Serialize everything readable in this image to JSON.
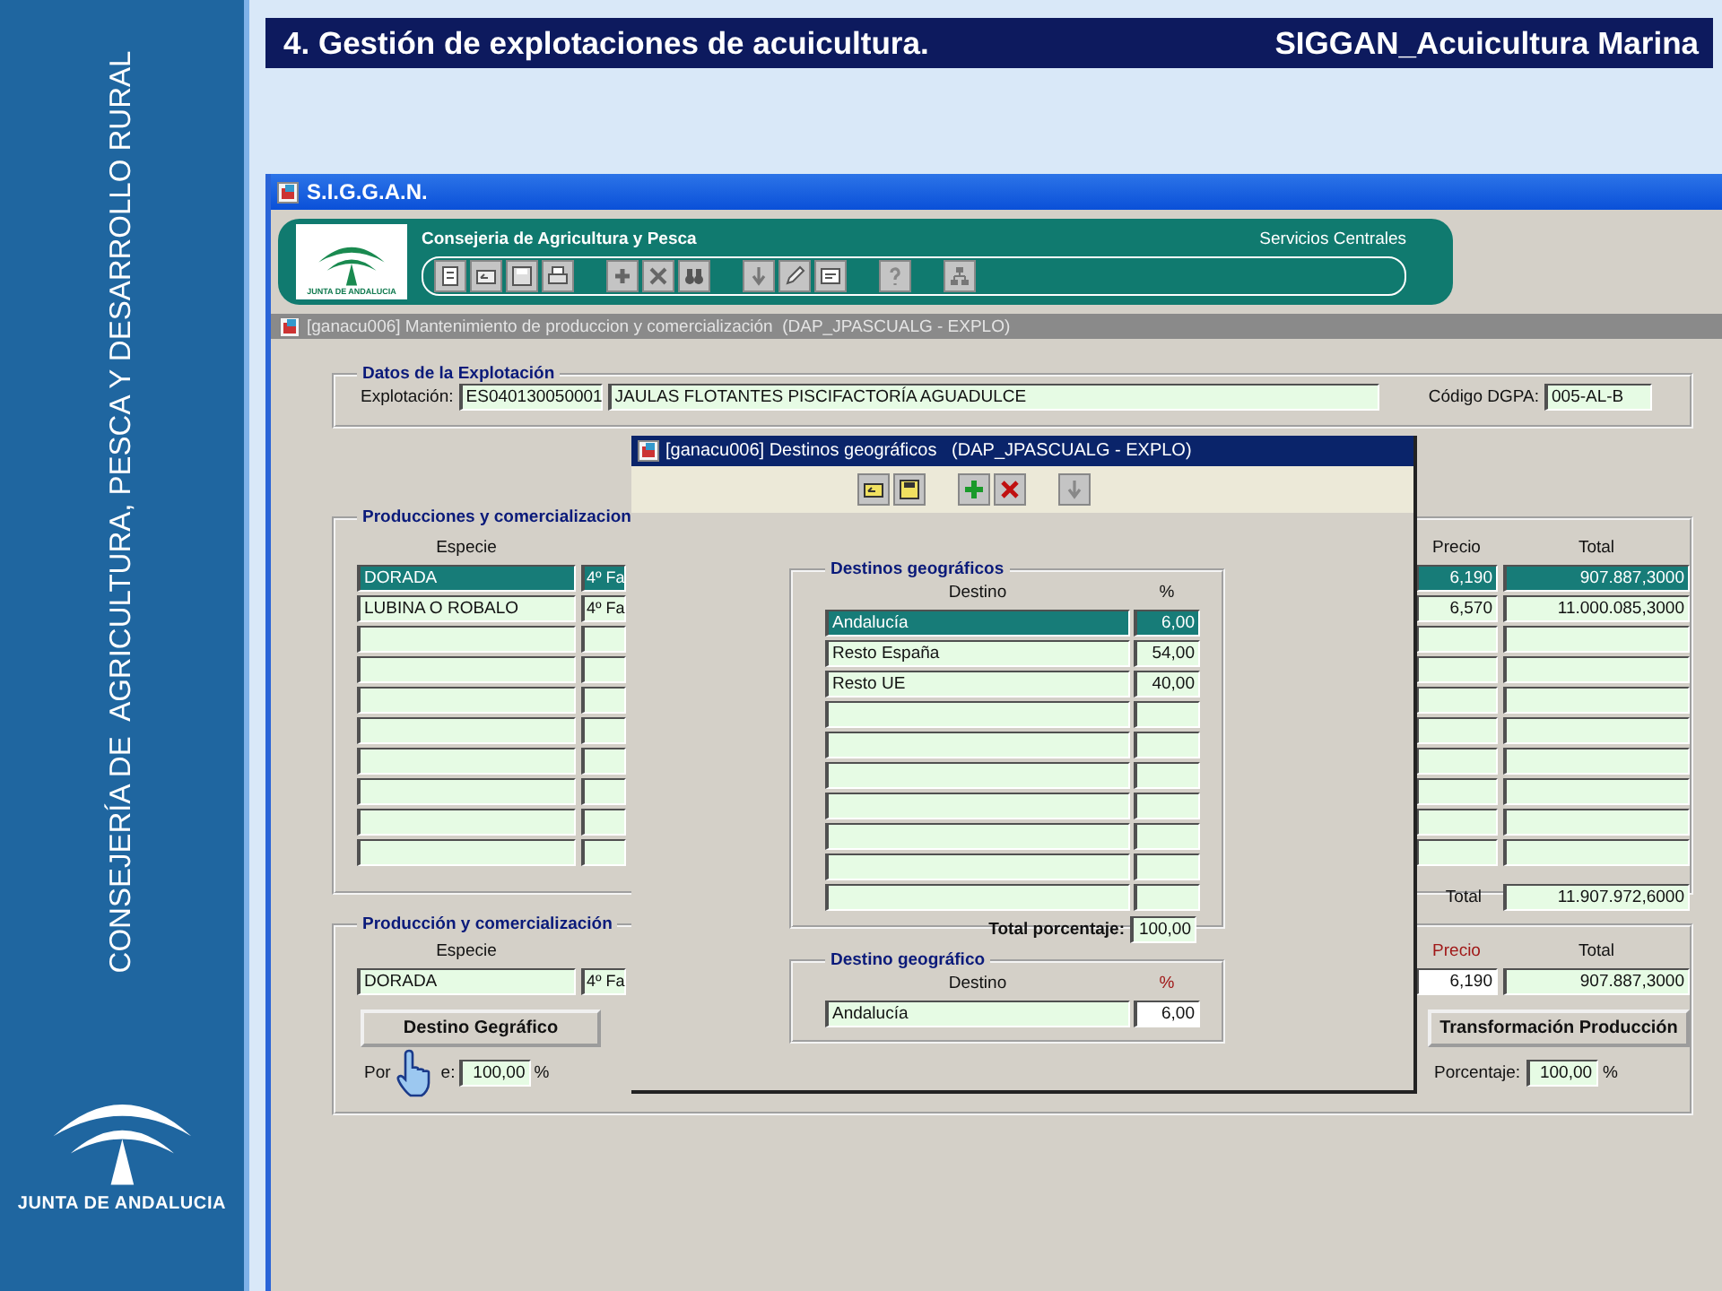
{
  "slide_header": {
    "title": "4. Gestión de explotaciones de acuicultura.",
    "subtitle": "SIGGAN_Acuicultura Marina"
  },
  "sidebar": {
    "text": "CONSEJERÍA DE  AGRICULTURA, PESCA Y DESARROLLO RURAL",
    "logo_text": "JUNTA DE ANDALUCIA"
  },
  "window": {
    "title": "S.I.G.G.A.N.",
    "org": "Consejeria de Agricultura y Pesca",
    "unit": "Servicios Centrales",
    "logo_text": "JUNTA DE ANDALUCIA"
  },
  "form": {
    "title": "[ganacu006] Mantenimiento de produccion y comercialización  (DAP_JPASCUALG - EXPLO)",
    "datos": {
      "legend": "Datos de la Explotación",
      "explotacion_label": "Explotación:",
      "explotacion_code": "ES040130050001",
      "explotacion_name": "JAULAS FLOTANTES PISCIFACTORÍA AGUADULCE",
      "dgpa_label": "Código DGPA:",
      "dgpa": "005-AL-B"
    },
    "producciones": {
      "legend": "Producciones y comercializacion",
      "columns": {
        "especie": "Especie",
        "precio": "Precio",
        "total": "Total"
      },
      "rows": [
        {
          "especie": "DORADA",
          "column_2": "4º Fa",
          "precio": "6,190",
          "total": "907.887,3000",
          "selected": true
        },
        {
          "especie": "LUBINA O ROBALO",
          "column_2": "4º Fa",
          "precio": "6,570",
          "total": "11.000.085,3000",
          "selected": false
        },
        {
          "selected": false
        },
        {
          "selected": false
        },
        {
          "selected": false
        },
        {
          "selected": false
        },
        {
          "selected": false
        },
        {
          "selected": false
        },
        {
          "selected": false
        },
        {
          "selected": false
        }
      ],
      "total_label": "Total",
      "total": "11.907.972,6000"
    },
    "produccion": {
      "legend": "Producción y comercialización",
      "columns": {
        "especie": "Especie",
        "precio": "Precio",
        "total": "Total"
      },
      "especie": "DORADA",
      "column_2": "4º Fa",
      "precio": "6,190",
      "total": "907.887,3000",
      "destino_button": "Destino Gegráfico",
      "transform_button": "Transformación Producción",
      "porcentaje_left": {
        "label_start": "Por",
        "label_end": "e:",
        "value": "100,00",
        "unit": "%"
      },
      "porcentaje_right": {
        "label": "Porcentaje:",
        "value": "100,00",
        "unit": "%"
      }
    }
  },
  "dialog": {
    "title": "[ganacu006] Destinos geográficos   (DAP_JPASCUALG - EXPLO)",
    "destinos": {
      "legend": "Destinos geográficos",
      "columns": {
        "destino": "Destino",
        "pct": "%"
      },
      "rows": [
        {
          "destino": "Andalucía",
          "pct": "6,00",
          "selected": true
        },
        {
          "destino": "Resto España",
          "pct": "54,00",
          "selected": false
        },
        {
          "destino": "Resto UE",
          "pct": "40,00",
          "selected": false
        },
        {
          "selected": false
        },
        {
          "selected": false
        },
        {
          "selected": false
        },
        {
          "selected": false
        },
        {
          "selected": false
        },
        {
          "selected": false
        },
        {
          "selected": false
        }
      ],
      "total_label": "Total porcentaje:",
      "total": "100,00"
    },
    "destino": {
      "legend": "Destino geográfico",
      "columns": {
        "destino": "Destino",
        "pct": "%"
      },
      "destino": "Andalucía",
      "pct": "6,00"
    }
  }
}
